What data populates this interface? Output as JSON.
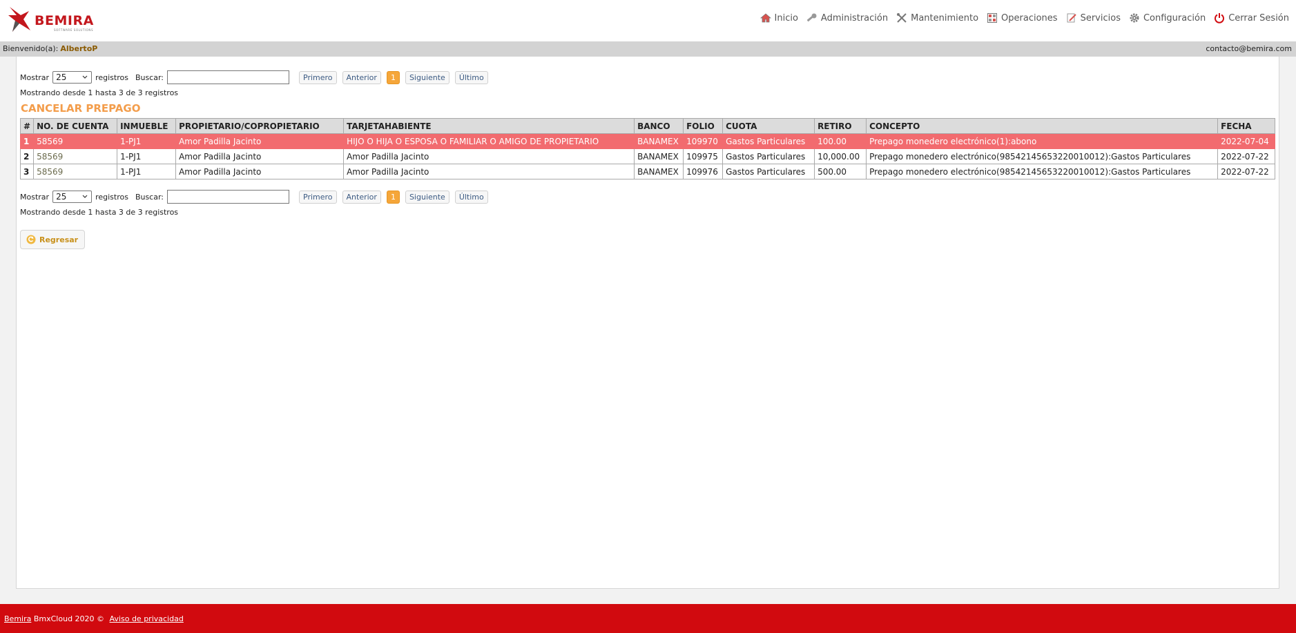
{
  "brand": {
    "name": "BEMIRA",
    "tagline": "SOFTWARE SOLUTIONS",
    "color": "#c3171d"
  },
  "nav": [
    {
      "label": "Inicio",
      "icon": "home-icon"
    },
    {
      "label": "Administración",
      "icon": "key-icon"
    },
    {
      "label": "Mantenimiento",
      "icon": "tools-icon"
    },
    {
      "label": "Operaciones",
      "icon": "calculator-icon"
    },
    {
      "label": "Servicios",
      "icon": "edit-icon"
    },
    {
      "label": "Configuración",
      "icon": "gear-icon"
    },
    {
      "label": "Cerrar Sesión",
      "icon": "power-icon"
    }
  ],
  "welcome": {
    "label": "Bienvenido(a):",
    "user": "AlbertoP",
    "email": "contacto@bemira.com"
  },
  "controls": {
    "show_label": "Mostrar",
    "show_value": "25",
    "records_label": "registros",
    "search_label": "Buscar:",
    "search_value": "",
    "pager": {
      "first": "Primero",
      "prev": "Anterior",
      "page": "1",
      "next": "Siguiente",
      "last": "Último"
    },
    "info": "Mostrando desde 1 hasta 3 de 3 registros"
  },
  "section_title": "CANCELAR PREPAGO",
  "table": {
    "columns": [
      "#",
      "NO. DE CUENTA",
      "INMUEBLE",
      "PROPIETARIO/COPROPIETARIO",
      "TARJETAHABIENTE",
      "BANCO",
      "FOLIO",
      "CUOTA",
      "RETIRO",
      "CONCEPTO",
      "FECHA"
    ],
    "rows": [
      [
        "1",
        "58569",
        "1-PJ1",
        "Amor Padilla Jacinto",
        "HIJO O HIJA O ESPOSA O FAMILIAR O AMIGO DE PROPIETARIO",
        "BANAMEX",
        "109970",
        "Gastos Particulares",
        "100.00",
        "Prepago monedero electrónico(1):abono",
        "2022-07-04"
      ],
      [
        "2",
        "58569",
        "1-PJ1",
        "Amor Padilla Jacinto",
        "Amor Padilla Jacinto",
        "BANAMEX",
        "109975",
        "Gastos Particulares",
        "10,000.00",
        "Prepago monedero electrónico(98542145653220010012):Gastos Particulares",
        "2022-07-22"
      ],
      [
        "3",
        "58569",
        "1-PJ1",
        "Amor Padilla Jacinto",
        "Amor Padilla Jacinto",
        "BANAMEX",
        "109976",
        "Gastos Particulares",
        "500.00",
        "Prepago monedero electrónico(98542145653220010012):Gastos Particulares",
        "2022-07-22"
      ]
    ],
    "selected_row_color": "#f26b6f"
  },
  "back_button": {
    "label": "Regresar",
    "icon": "back-arrow-icon"
  },
  "footer": {
    "brand": "Bemira",
    "text": " BmxCloud 2020 © ",
    "privacy": "Aviso de privacidad",
    "color": "#d10a0f"
  }
}
